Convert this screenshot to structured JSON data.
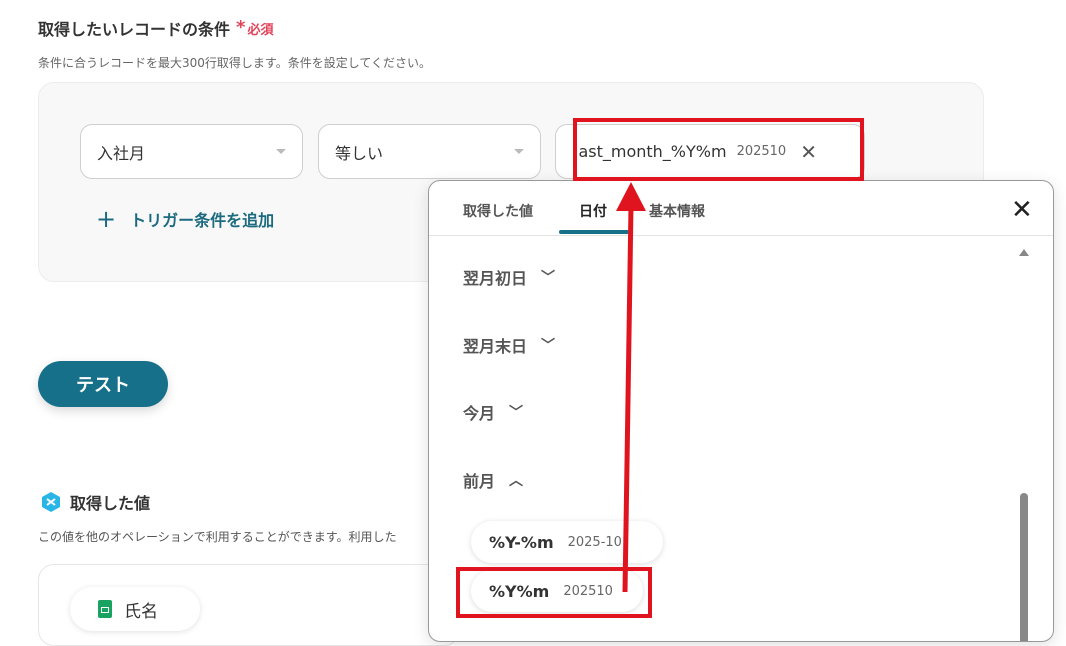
{
  "header": {
    "title": "取得したいレコードの条件",
    "required_star": "*",
    "required_label": "必須",
    "description": "条件に合うレコードを最大300行取得します。条件を設定してください。"
  },
  "condition": {
    "field": "入社月",
    "operator": "等しい",
    "value_key": "last_month_%Y%m",
    "value_preview": "202510",
    "add_trigger": "トリガー条件を追加"
  },
  "test_button": "テスト",
  "acquired": {
    "title": "取得した値",
    "description": "この値を他のオペレーションで利用することができます。利用した",
    "chip_label": "氏名"
  },
  "popup": {
    "tabs": [
      "取得した値",
      "日付",
      "基本情報"
    ],
    "active_tab": "日付",
    "groups": [
      {
        "label": "翌月初日",
        "expanded": false
      },
      {
        "label": "翌月末日",
        "expanded": false
      },
      {
        "label": "今月",
        "expanded": false
      },
      {
        "label": "前月",
        "expanded": true
      }
    ],
    "options": [
      {
        "key": "%Y-%m",
        "value": "2025-10"
      },
      {
        "key": "%Y%m",
        "value": "202510"
      }
    ],
    "close_icon": "close-icon"
  },
  "colors": {
    "accent": "#17708a",
    "required": "#e0445b",
    "annotation": "#e0141e"
  }
}
